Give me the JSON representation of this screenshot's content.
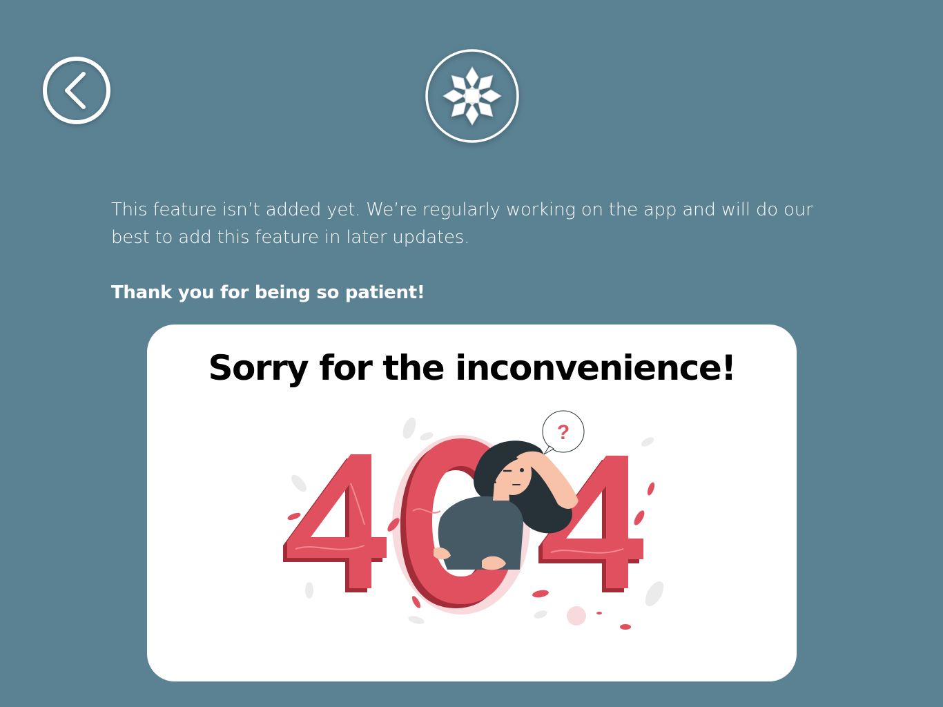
{
  "nav": {
    "back_icon": "chevron-left-icon"
  },
  "logo": {
    "icon": "snowflake-flower-logo"
  },
  "message": {
    "body": "This feature isn’t added yet. We’re regularly working on the app and will do our best to add this feature in later updates.",
    "thanks": "Thank you for being so patient!"
  },
  "card": {
    "title": "Sorry for the inconvenience!",
    "illustration": {
      "digits": "404",
      "bubble": "?"
    }
  },
  "colors": {
    "background": "#5b8293",
    "card": "#ffffff",
    "accent_red": "#e0505e",
    "accent_dark_red": "#a32c39",
    "shirt": "#455a64",
    "hair": "#263238"
  }
}
